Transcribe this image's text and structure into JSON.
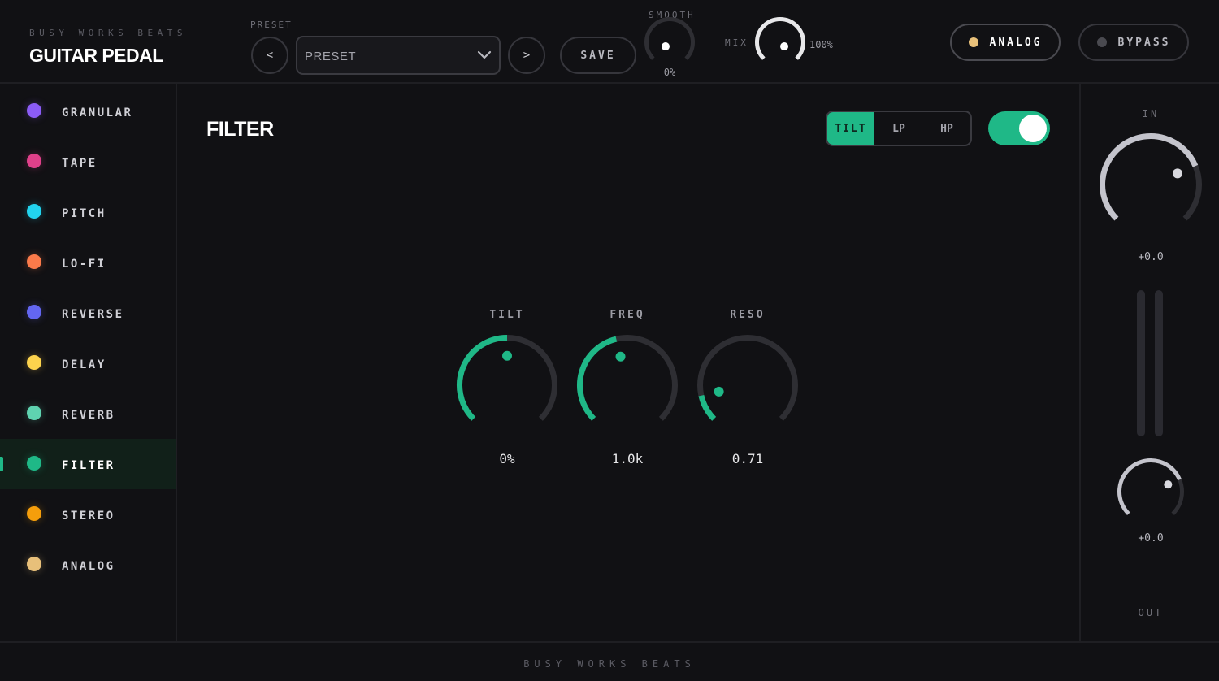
{
  "header": {
    "brand_small": "BUSY WORKS BEATS",
    "title": "GUITAR PEDAL",
    "preset_label": "PRESET",
    "prev_label": "<",
    "next_label": ">",
    "preset_value": "PRESET",
    "save_label": "SAVE",
    "smooth": {
      "label": "SMOOTH",
      "value": "0%",
      "level": 0
    },
    "mix": {
      "label": "MIX",
      "value": "100%",
      "level": 1
    },
    "analog": {
      "label": "ANALOG",
      "dot_color": "#e8c07a"
    },
    "bypass": {
      "label": "BYPASS",
      "dot_color": "#4a4a50"
    }
  },
  "sidebar": {
    "items": [
      {
        "label": "GRANULAR",
        "color": "#8b5cf6"
      },
      {
        "label": "TAPE",
        "color": "#e0408a"
      },
      {
        "label": "PITCH",
        "color": "#22d3ee"
      },
      {
        "label": "LO-FI",
        "color": "#fb7a4a"
      },
      {
        "label": "REVERSE",
        "color": "#6366f1"
      },
      {
        "label": "DELAY",
        "color": "#fcd34d"
      },
      {
        "label": "REVERB",
        "color": "#5fd3b0"
      },
      {
        "label": "FILTER",
        "color": "#1fb887",
        "active": true
      },
      {
        "label": "STEREO",
        "color": "#f59e0b"
      },
      {
        "label": "ANALOG",
        "color": "#e8c07a"
      }
    ]
  },
  "main": {
    "section_title": "FILTER",
    "modes": [
      "TILT",
      "LP",
      "HP"
    ],
    "selected_mode": "TILT",
    "enabled": true,
    "accent": "#1fb887",
    "knobs": [
      {
        "label": "TILT",
        "value": "0%",
        "level": 0.5
      },
      {
        "label": "FREQ",
        "value": "1.0k",
        "level": 0.45
      },
      {
        "label": "RESO",
        "value": "0.71",
        "level": 0.12
      }
    ]
  },
  "io": {
    "in_label": "IN",
    "in_value": "+0.0",
    "in_level": 0.75,
    "out_value": "+0.0",
    "out_level": 0.75,
    "out_label": "OUT"
  },
  "footer": {
    "text": "BUSY WORKS BEATS"
  }
}
